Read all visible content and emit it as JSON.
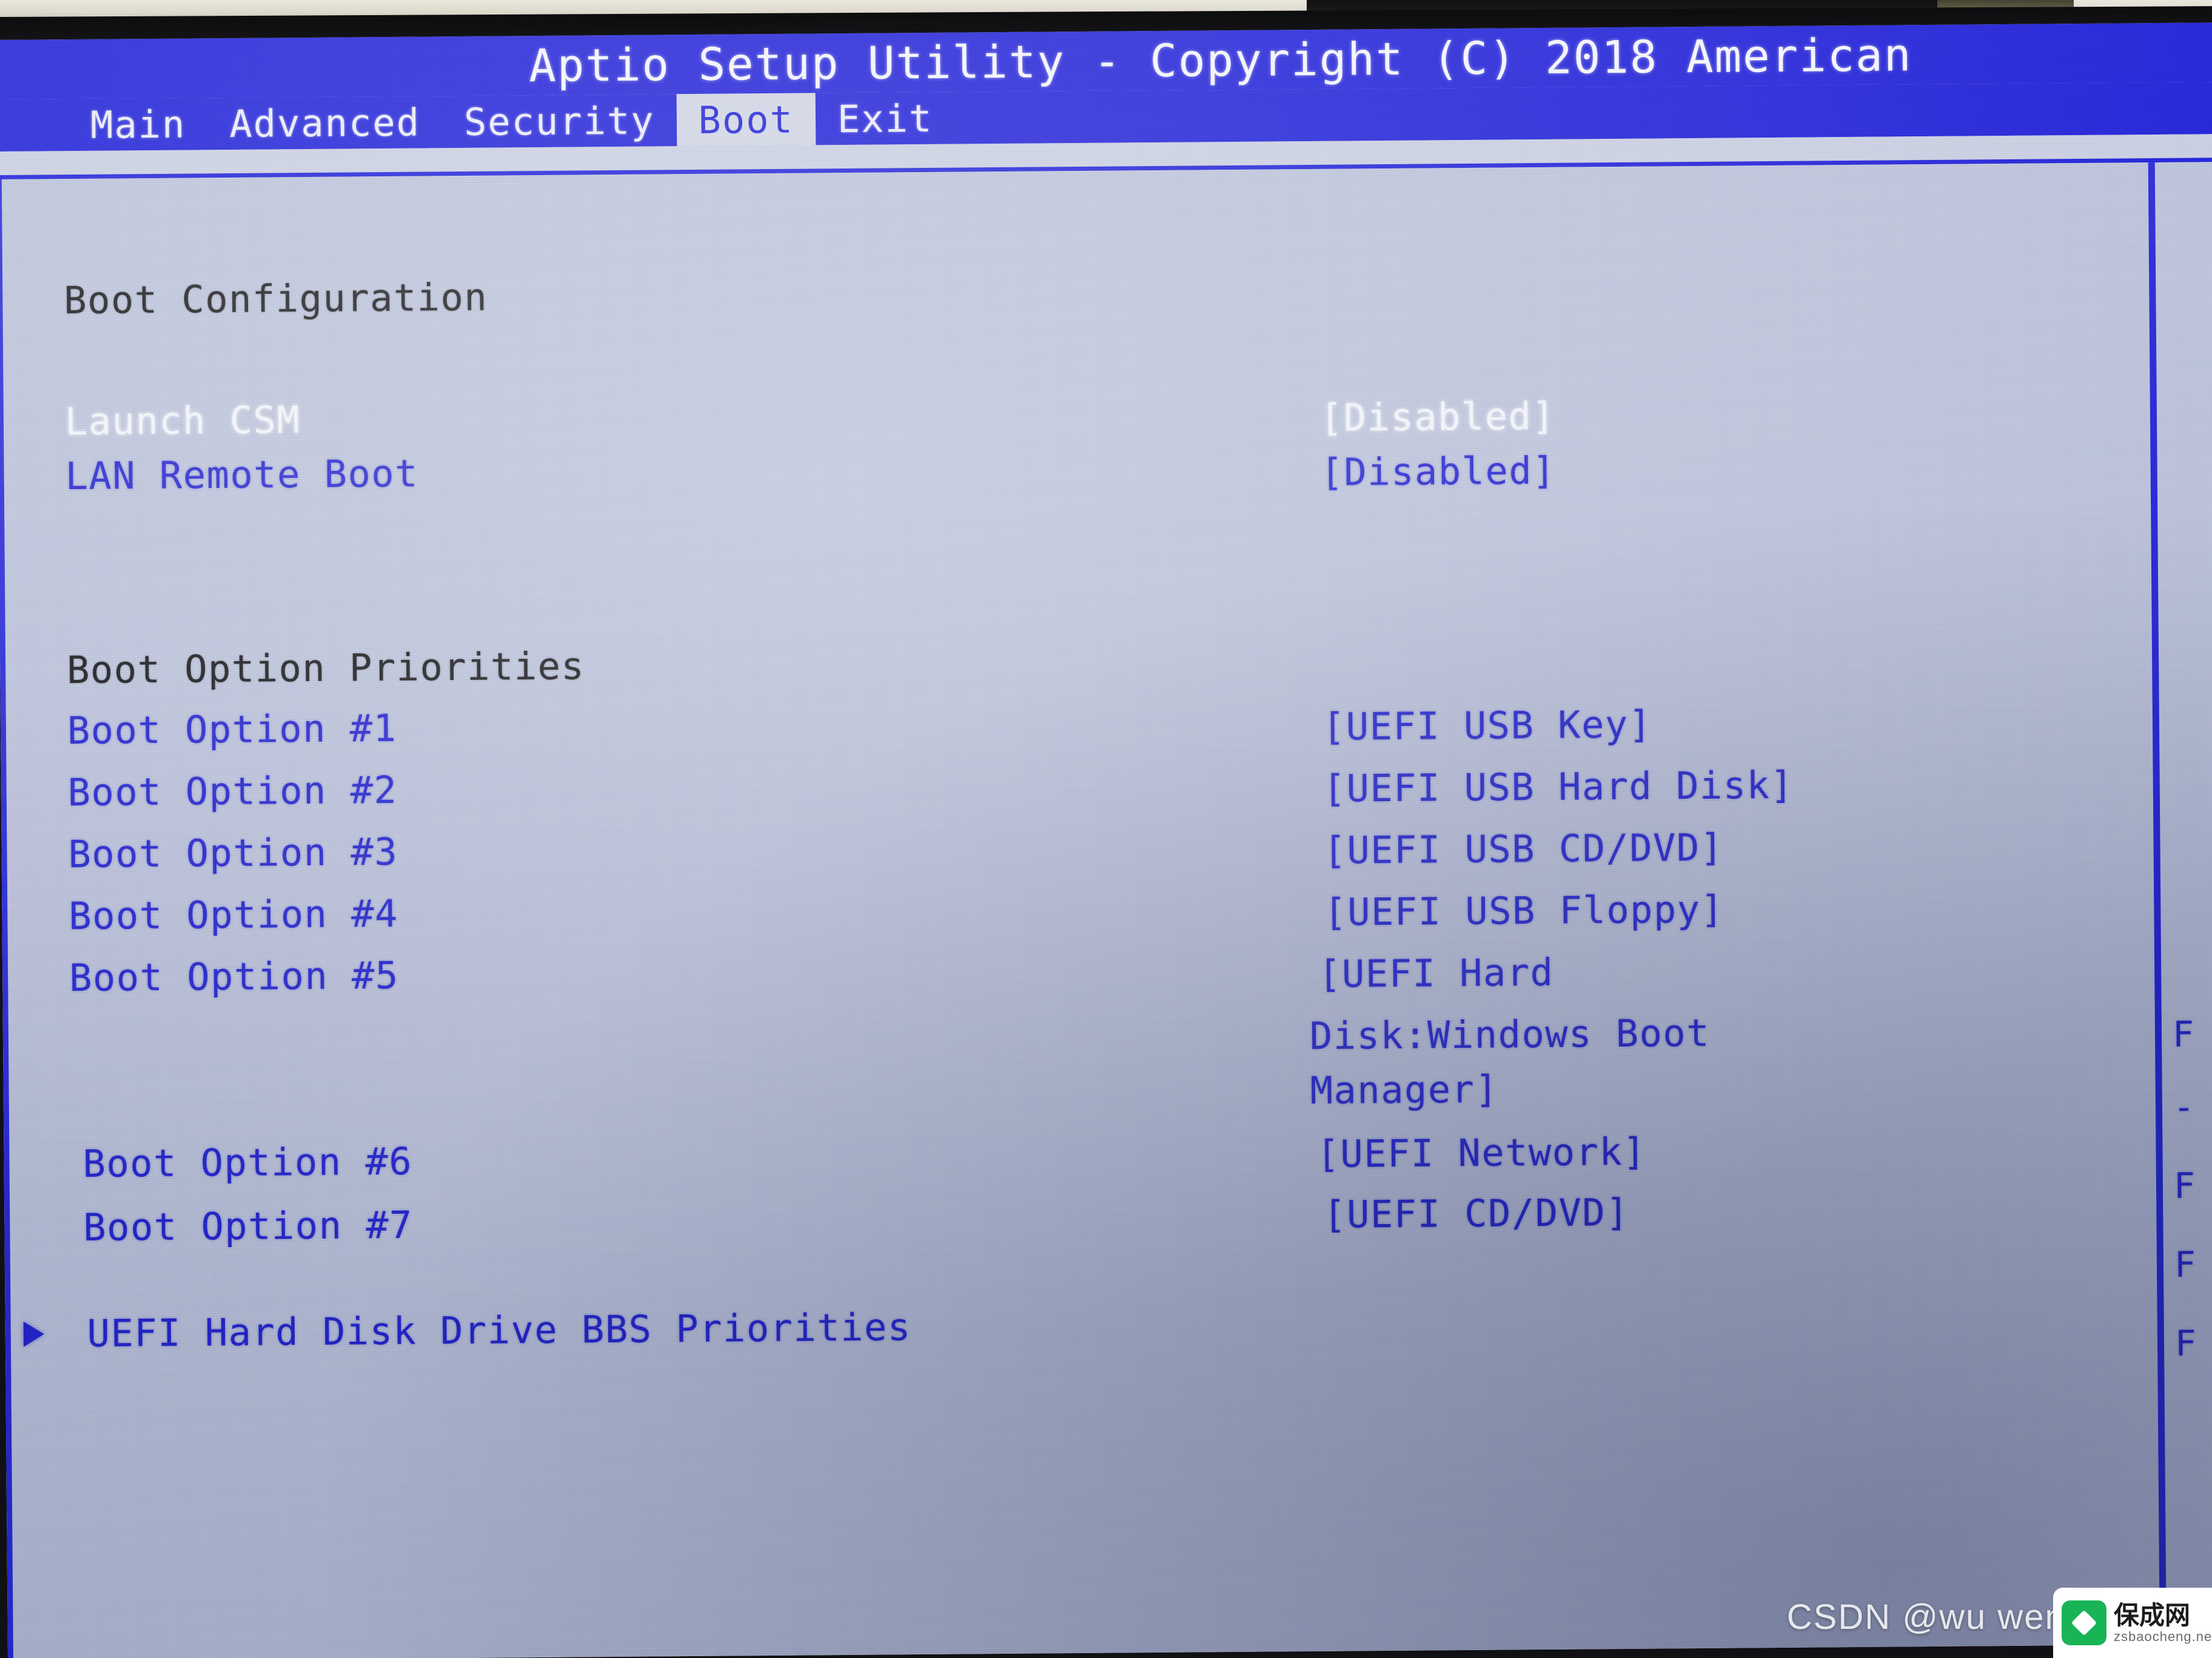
{
  "window": {
    "title": "Aptio Setup Utility - Copyright (C) 2018 American",
    "active_tab": "Boot"
  },
  "tabs": [
    {
      "label": "Main",
      "active": false
    },
    {
      "label": "Advanced",
      "active": false
    },
    {
      "label": "Security",
      "active": false
    },
    {
      "label": "Boot",
      "active": true
    },
    {
      "label": "Exit",
      "active": false
    }
  ],
  "boot_page": {
    "section_title": "Boot Configuration",
    "settings": [
      {
        "label": "Launch CSM",
        "value": "[Disabled]",
        "style": "gray"
      },
      {
        "label": "LAN Remote Boot",
        "value": "[Disabled]",
        "style": "blue"
      }
    ],
    "priorities_title": "Boot Option Priorities",
    "priorities": [
      {
        "label": "Boot Option #1",
        "value": "[UEFI USB Key]"
      },
      {
        "label": "Boot Option #2",
        "value": "[UEFI USB Hard Disk]"
      },
      {
        "label": "Boot Option #3",
        "value": "[UEFI USB CD/DVD]"
      },
      {
        "label": "Boot Option #4",
        "value": "[UEFI USB Floppy]"
      },
      {
        "label": "Boot Option #5",
        "value": "[UEFI Hard Disk:Windows Boot Manager]"
      },
      {
        "label": "Boot Option #6",
        "value": "[UEFI Network]"
      },
      {
        "label": "Boot Option #7",
        "value": "[UEFI CD/DVD]"
      }
    ],
    "value_wrap_line1": "[UEFI Hard",
    "value_wrap_line2": "Disk:Windows Boot",
    "value_wrap_line3": "Manager]",
    "submenu": {
      "arrow": "submenu-arrow-icon",
      "label": "UEFI Hard Disk Drive BBS Priorities"
    }
  },
  "help_column": {
    "cropped_lines": [
      "F",
      "-",
      "F",
      "F",
      "F"
    ]
  },
  "watermark": {
    "csdn": "CSDN @wu wendy",
    "badge_title": "保成网",
    "badge_domain": "zsbaocheng.net"
  },
  "colors": {
    "header_blue": "#1a1ad6",
    "screen_bg": "#b9c0d8",
    "text_blue": "#2222cc",
    "text_dark": "#18181c",
    "text_light": "#f0f2f8",
    "active_tab_bg": "#cdd2e2"
  }
}
